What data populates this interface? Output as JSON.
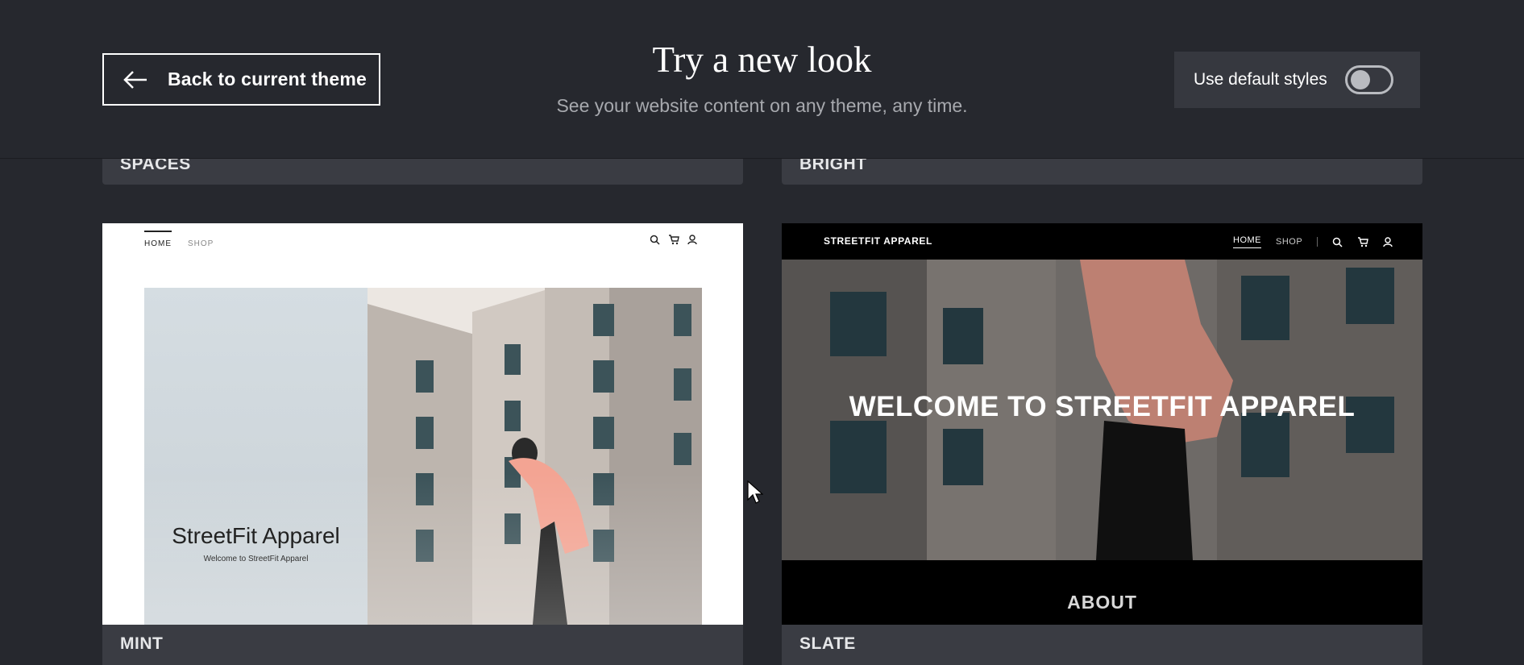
{
  "header": {
    "back_label": "Back to current theme",
    "title": "Try a new look",
    "subtitle": "See your website content on any theme, any time.",
    "toggle_label": "Use default styles",
    "toggle_on": false
  },
  "themes_top": [
    {
      "name": "SPACES"
    },
    {
      "name": "BRIGHT"
    }
  ],
  "themes": [
    {
      "name": "MINT",
      "nav": [
        "HOME",
        "SHOP"
      ],
      "site_title": "StreetFit Apparel",
      "site_tagline": "Welcome to StreetFit Apparel"
    },
    {
      "name": "SLATE",
      "logo": "STREETFIT APPAREL",
      "nav": [
        "HOME",
        "SHOP"
      ],
      "headline": "WELCOME TO STREETFIT APPAREL",
      "section": "ABOUT"
    }
  ],
  "colors": {
    "background": "#26282e",
    "card_bar": "#3a3c43",
    "accent_hoodie": "#f3a493"
  },
  "icons": [
    "arrow-left-icon",
    "search-icon",
    "cart-icon",
    "user-icon",
    "cursor-icon"
  ]
}
